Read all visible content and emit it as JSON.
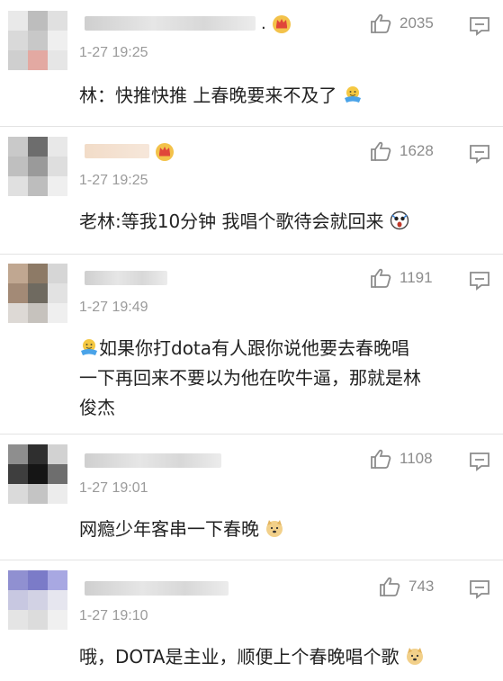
{
  "comments": [
    {
      "username": "",
      "username_suffix": ".",
      "timestamp": "1-27 19:25",
      "likes": "2035",
      "text_prefix": "",
      "text": "林：快推快推 上春晚要来不及了",
      "text_line2": "",
      "text_line3": ""
    },
    {
      "username": "",
      "username_suffix": "",
      "timestamp": "1-27 19:25",
      "likes": "1628",
      "text_prefix": "",
      "text": "老林:等我10分钟  我唱个歌待会就回来",
      "text_line2": "",
      "text_line3": ""
    },
    {
      "username": "",
      "username_suffix": "",
      "timestamp": "1-27 19:49",
      "likes": "1191",
      "text_prefix": "",
      "text": "如果你打dota有人跟你说他要去春晚唱",
      "text_line2": "一下再回来不要以为他在吹牛逼，那就是林",
      "text_line3": "俊杰"
    },
    {
      "username": "",
      "username_suffix": "",
      "timestamp": "1-27 19:01",
      "likes": "1108",
      "text_prefix": "",
      "text": "网瘾少年客串一下春晚",
      "text_line2": "",
      "text_line3": ""
    },
    {
      "username": "",
      "username_suffix": "",
      "timestamp": "1-27 19:10",
      "likes": "743",
      "text_prefix": "",
      "text": "哦，DOTA是主业，顺便上个春晚唱个歌",
      "text_line2": "",
      "text_line3": ""
    }
  ],
  "icons": {
    "like": "thumbs-up-icon",
    "reply": "reply-comment-icon",
    "badge": "crown-badge-icon",
    "emoji_blessing": "blessing-emoji-icon",
    "emoji_shocked": "shocked-emoji-icon",
    "emoji_doge": "doge-emoji-icon"
  },
  "colors": {
    "text": "#222222",
    "meta": "#9a9a9a",
    "like": "#8c8c8c",
    "divider": "#e3e3e3",
    "crown": "#e8a33a"
  }
}
